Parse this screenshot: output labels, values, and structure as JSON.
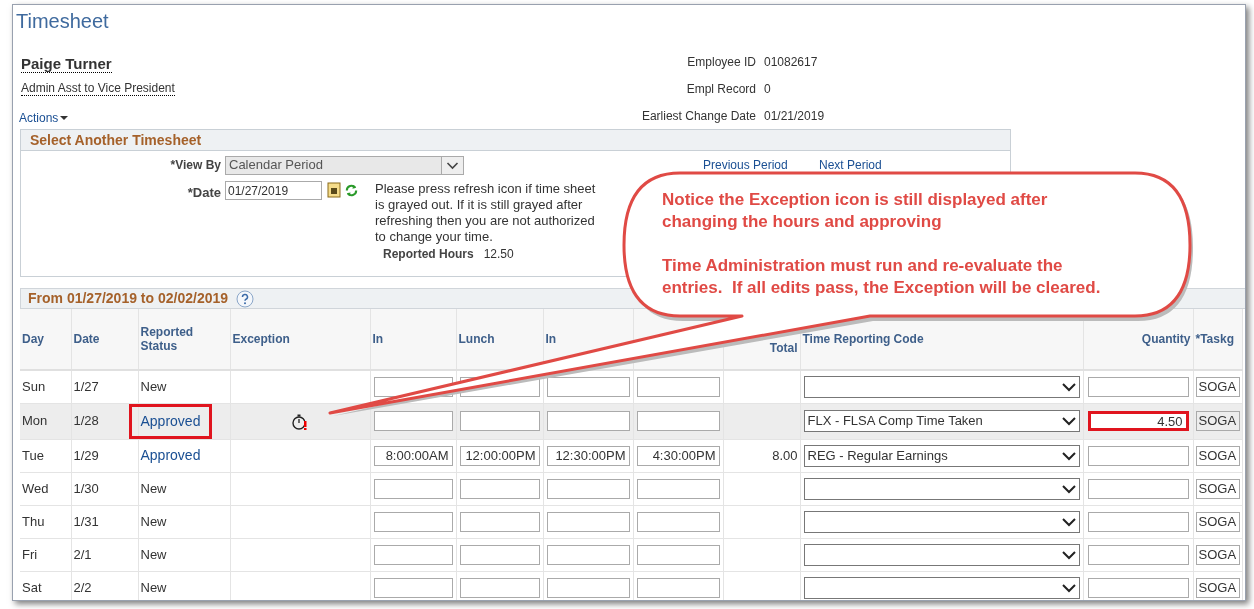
{
  "page_title": "Timesheet",
  "employee": {
    "name": "Paige Turner",
    "job_title": "Admin Asst to Vice President"
  },
  "info": [
    {
      "label": "Employee ID",
      "value": "01082617"
    },
    {
      "label": "Empl Record",
      "value": "0"
    },
    {
      "label": "Earliest Change Date",
      "value": "01/21/2019"
    }
  ],
  "actions_menu": "Actions",
  "select_panel": {
    "title": "Select Another Timesheet",
    "view_by_label": "*View By",
    "view_by_value": "Calendar Period",
    "date_label": "*Date",
    "date_value": "01/27/2019",
    "note": "Please press refresh icon if time sheet is grayed out. If it is still grayed after refreshing then you are not authorized to change your time.",
    "reported_hours_label": "Reported Hours",
    "reported_hours_value": "12.50",
    "previous_link": "Previous Period",
    "next_link": "Next Period"
  },
  "grid": {
    "title": "From 01/27/2019 to 02/02/2019",
    "columns": [
      "Day",
      "Date",
      "Reported Status",
      "Exception",
      "In",
      "Lunch",
      "In",
      null,
      "Total",
      "Time Reporting Code",
      "Quantity",
      "*Taskg"
    ],
    "rows": [
      {
        "day": "Sun",
        "date": "1/27",
        "status": "New",
        "kind": "new",
        "exception": false,
        "selected": false,
        "status_marked": false,
        "quantity_marked": false,
        "taskgroup": "SOGA"
      },
      {
        "day": "Mon",
        "date": "1/28",
        "status": "Approved",
        "kind": "approved",
        "exception": true,
        "selected": true,
        "status_marked": true,
        "quantity_marked": true,
        "code": "FLX - FLSA Comp Time Taken",
        "quantity": "4.50",
        "taskgroup": "SOGA"
      },
      {
        "day": "Tue",
        "date": "1/29",
        "status": "Approved",
        "kind": "approved",
        "exception": false,
        "selected": false,
        "status_marked": false,
        "quantity_marked": false,
        "in": "8:00:00AM",
        "lunch": "12:00:00PM",
        "in_2": "12:30:00PM",
        "out": "4:30:00PM",
        "total": "8.00",
        "code": "REG - Regular Earnings",
        "taskgroup": "SOGA"
      },
      {
        "day": "Wed",
        "date": "1/30",
        "status": "New",
        "kind": "new",
        "exception": false,
        "selected": false,
        "status_marked": false,
        "quantity_marked": false,
        "taskgroup": "SOGA"
      },
      {
        "day": "Thu",
        "date": "1/31",
        "status": "New",
        "kind": "new",
        "exception": false,
        "selected": false,
        "status_marked": false,
        "quantity_marked": false,
        "taskgroup": "SOGA"
      },
      {
        "day": "Fri",
        "date": "2/1",
        "status": "New",
        "kind": "new",
        "exception": false,
        "selected": false,
        "status_marked": false,
        "quantity_marked": false,
        "taskgroup": "SOGA"
      },
      {
        "day": "Sat",
        "date": "2/2",
        "status": "New",
        "kind": "new",
        "exception": false,
        "selected": false,
        "status_marked": false,
        "quantity_marked": false,
        "taskgroup": "SOGA"
      }
    ]
  },
  "callout": {
    "lines": [
      "Notice the Exception icon is still displayed after changing the hours and approving",
      "Time Administration must run and re-evaluate the entries.  If all edits pass, the Exception will be cleared."
    ]
  }
}
